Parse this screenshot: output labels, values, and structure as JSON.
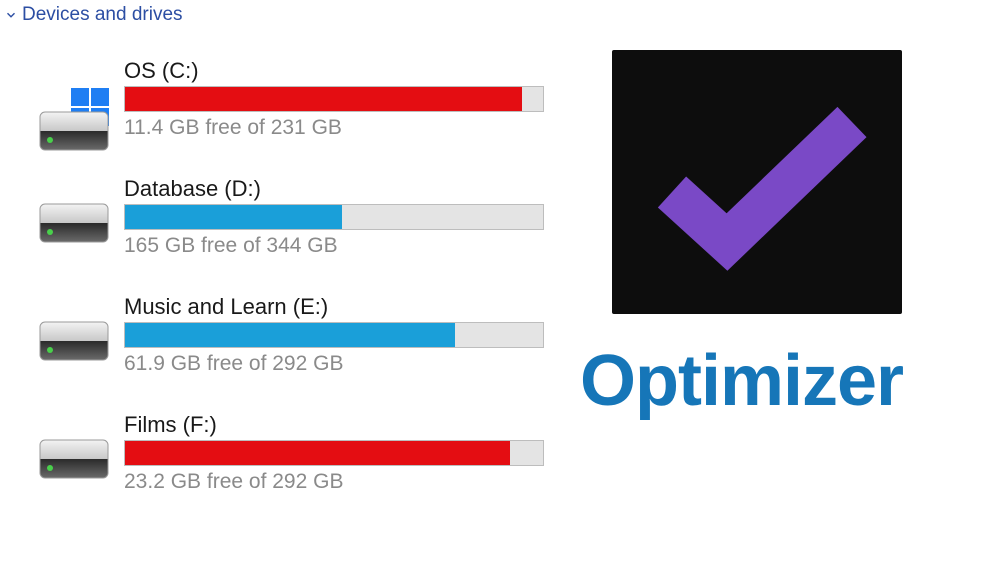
{
  "section": {
    "title": "Devices and drives"
  },
  "drives": [
    {
      "name": "OS (C:)",
      "free_gb": 11.4,
      "total_gb": 231,
      "info": "11.4 GB free of 231 GB",
      "os": true,
      "fill_class": "fill-red",
      "used_pct": 95
    },
    {
      "name": "Database (D:)",
      "free_gb": 165,
      "total_gb": 344,
      "info": "165 GB free of 344 GB",
      "os": false,
      "fill_class": "fill-blue",
      "used_pct": 52
    },
    {
      "name": "Music and Learn (E:)",
      "free_gb": 61.9,
      "total_gb": 292,
      "info": "61.9 GB free of 292 GB",
      "os": false,
      "fill_class": "fill-blue",
      "used_pct": 79
    },
    {
      "name": "Films (F:)",
      "free_gb": 23.2,
      "total_gb": 292,
      "info": "23.2 GB free of 292 GB",
      "os": false,
      "fill_class": "fill-red",
      "used_pct": 92
    }
  ],
  "app": {
    "title": "Optimizer",
    "icon_name": "checkmark-icon",
    "accent_color": "#7a49c6"
  },
  "icons": {
    "chevron": "chevron-down-icon",
    "windows": "windows-logo-icon",
    "drive": "hdd-icon"
  }
}
